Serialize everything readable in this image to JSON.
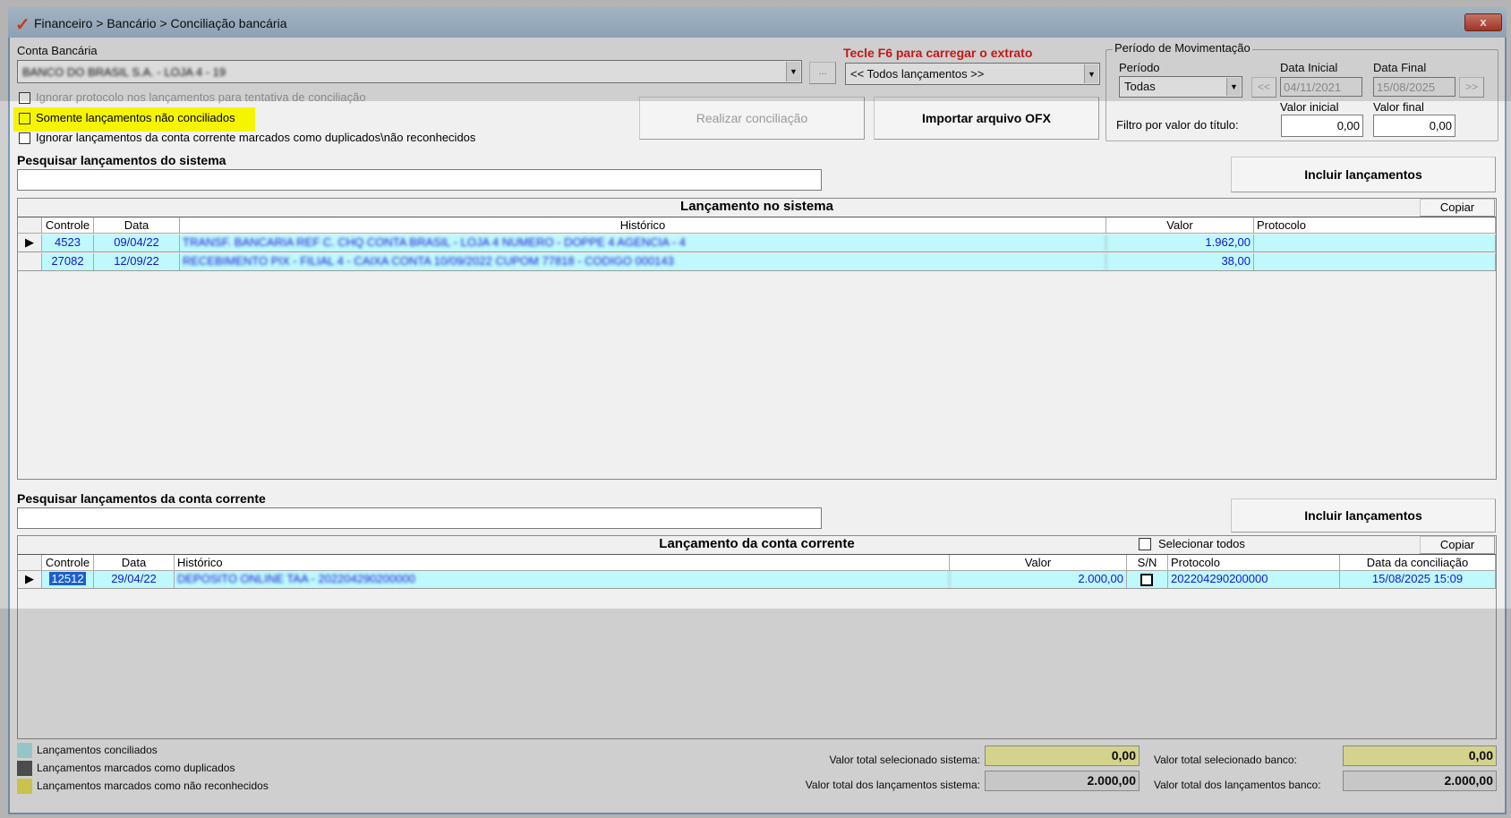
{
  "window": {
    "title": "Financeiro > Bancário > Conciliação bancária",
    "close": "x"
  },
  "account": {
    "label": "Conta Bancária",
    "value": "BANCO DO BRASIL S.A. - LOJA 4 - 19",
    "ellipsis": "...",
    "hint": "Tecle F6 para carregar o extrato",
    "filter_value": "<< Todos lançamentos >>"
  },
  "options": {
    "ignore_protocol": "Ignorar protocolo nos lançamentos para tentativa de conciliação",
    "only_unreconciled": "Somente lançamentos não conciliados",
    "ignore_duplicates": "Ignorar lançamentos da conta corrente marcados como duplicados\\não reconhecidos"
  },
  "buttons": {
    "reconcile": "Realizar conciliação",
    "import_ofx": "Importar arquivo OFX",
    "include": "Incluir lançamentos",
    "copy": "Copiar"
  },
  "period": {
    "group": "Período de Movimentação",
    "label": "Período",
    "value": "Todas",
    "start_label": "Data Inicial",
    "start": "04/11/2021",
    "end_label": "Data Final",
    "end": "15/08/2025",
    "prev": "<<",
    "next": ">>",
    "filter_label": "Filtro por valor do título:",
    "min_label": "Valor inicial",
    "min": "0,00",
    "max_label": "Valor final",
    "max": "0,00"
  },
  "system": {
    "search_label": "Pesquisar lançamentos do sistema",
    "title": "Lançamento no sistema",
    "columns": [
      "Controle",
      "Data",
      "Histórico",
      "Valor",
      "Protocolo"
    ],
    "rows": [
      {
        "controle": "4523",
        "data": "09/04/22",
        "historico": "TRANSF. BANCARIA REF C. CHQ CONTA BRASIL - LOJA 4 NUMERO - DOPPE 4 AGENCIA - 4",
        "valor": "1.962,00",
        "protocolo": ""
      },
      {
        "controle": "27082",
        "data": "12/09/22",
        "historico": "RECEBIMENTO PIX - FILIAL 4 - CAIXA CONTA 10/09/2022 CUPOM 77818 - CODIGO 000143",
        "valor": "38,00",
        "protocolo": ""
      }
    ]
  },
  "bank": {
    "search_label": "Pesquisar lançamentos da conta corrente",
    "title": "Lançamento da conta corrente",
    "select_all": "Selecionar todos",
    "columns": [
      "Controle",
      "Data",
      "Histórico",
      "Valor",
      "S/N",
      "Protocolo",
      "Data da conciliação"
    ],
    "rows": [
      {
        "controle": "12512",
        "data": "29/04/22",
        "historico": "DEPOSITO ONLINE TAA - 202204290200000",
        "valor": "2.000,00",
        "protocolo": "202204290200000",
        "data_conciliacao": "15/08/2025 15:09"
      }
    ]
  },
  "legend": [
    {
      "label": "Lançamentos conciliados",
      "color": "#a8e4e8"
    },
    {
      "label": "Lançamentos marcados como duplicados",
      "color": "#505050"
    },
    {
      "label": "Lançamentos marcados como não reconhecidos",
      "color": "#e8e050"
    }
  ],
  "totals": {
    "sel_sys_label": "Valor total selecionado sistema:",
    "sel_sys": "0,00",
    "all_sys_label": "Valor total dos lançamentos sistema:",
    "all_sys": "2.000,00",
    "sel_bank_label": "Valor total selecionado banco:",
    "sel_bank": "0,00",
    "all_bank_label": "Valor total dos lançamentos banco:",
    "all_bank": "2.000,00"
  }
}
